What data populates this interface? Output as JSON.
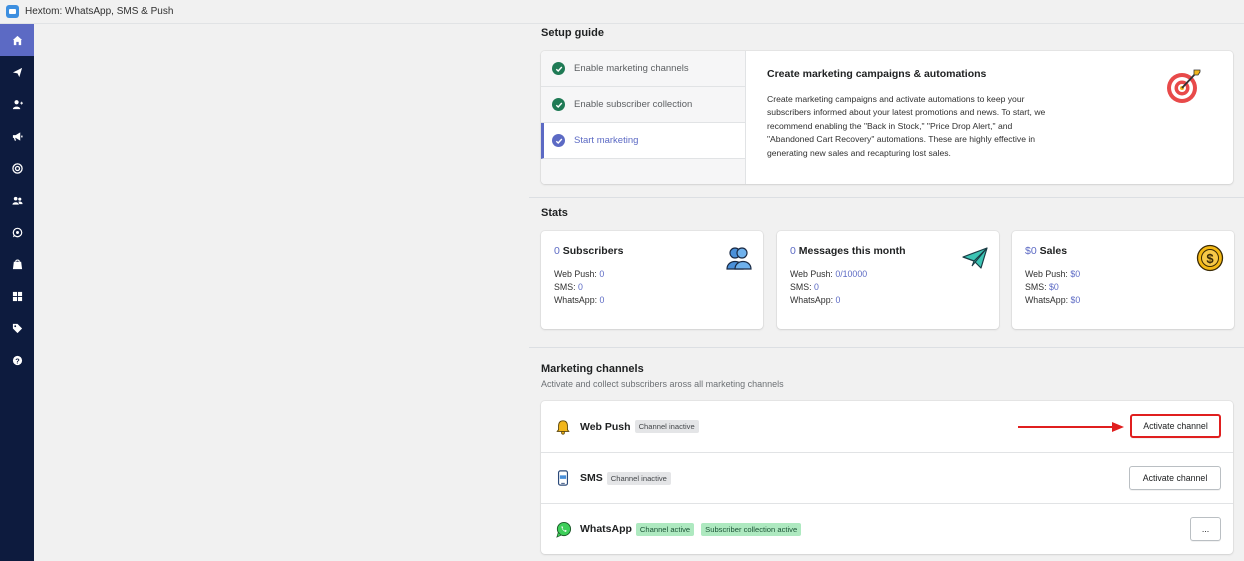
{
  "app": {
    "title": "Hextom: WhatsApp, SMS & Push"
  },
  "sidebar": {
    "items": [
      {
        "icon": "home-icon",
        "active": true
      },
      {
        "icon": "send-icon"
      },
      {
        "icon": "add-user-icon"
      },
      {
        "icon": "megaphone-icon"
      },
      {
        "icon": "target-icon"
      },
      {
        "icon": "users-icon"
      },
      {
        "icon": "whatsapp-icon"
      },
      {
        "icon": "store-icon"
      },
      {
        "icon": "apps-icon"
      },
      {
        "icon": "tag-icon"
      },
      {
        "icon": "help-icon"
      }
    ]
  },
  "setup_guide": {
    "title": "Setup guide",
    "steps": [
      {
        "label": "Enable marketing channels",
        "done": true
      },
      {
        "label": "Enable subscriber collection",
        "done": true
      },
      {
        "label": "Start marketing",
        "active": true
      }
    ],
    "content_title": "Create marketing campaigns & automations",
    "content_body": "Create marketing campaigns and activate automations to keep your subscribers informed about your latest promotions and news. To start, we recommend enabling the \"Back in Stock,\" \"Price Drop Alert,\" and \"Abandoned Cart Recovery\" automations. These are highly effective in generating new sales and recapturing lost sales."
  },
  "stats": {
    "title": "Stats",
    "cards": [
      {
        "num": "0",
        "label": " Subscribers",
        "icon": "subscribers-icon",
        "lines": [
          {
            "k": "Web Push: ",
            "v": "0"
          },
          {
            "k": "SMS: ",
            "v": "0"
          },
          {
            "k": "WhatsApp: ",
            "v": "0"
          }
        ]
      },
      {
        "num": "0",
        "label": " Messages this month",
        "icon": "paper-plane-icon",
        "lines": [
          {
            "k": "Web Push: ",
            "v": "0/10000"
          },
          {
            "k": "SMS: ",
            "v": "0"
          },
          {
            "k": "WhatsApp: ",
            "v": "0"
          }
        ]
      },
      {
        "num": "$0",
        "label": " Sales",
        "icon": "dollar-coin-icon",
        "lines": [
          {
            "k": "Web Push: ",
            "v": "$0"
          },
          {
            "k": "SMS: ",
            "v": "$0"
          },
          {
            "k": "WhatsApp: ",
            "v": "$0"
          }
        ]
      }
    ]
  },
  "marketing_channels": {
    "title": "Marketing channels",
    "subtitle": "Activate and collect subscribers aross all marketing channels",
    "channels": [
      {
        "name": "Web Push",
        "badges": [
          "Channel inactive"
        ],
        "action": "Activate channel",
        "icon": "bell-icon"
      },
      {
        "name": "SMS",
        "badges": [
          "Channel inactive"
        ],
        "action": "Activate channel",
        "icon": "phone-sms-icon"
      },
      {
        "name": "WhatsApp",
        "badges": [
          "Channel active",
          "Subscriber collection active"
        ],
        "action": "...",
        "icon": "whatsapp-icon"
      }
    ]
  },
  "colors": {
    "accent": "#5c6ac4",
    "sidebar": "#0d1b3e",
    "success": "#1f7a55",
    "highlight": "#e01f1f"
  }
}
